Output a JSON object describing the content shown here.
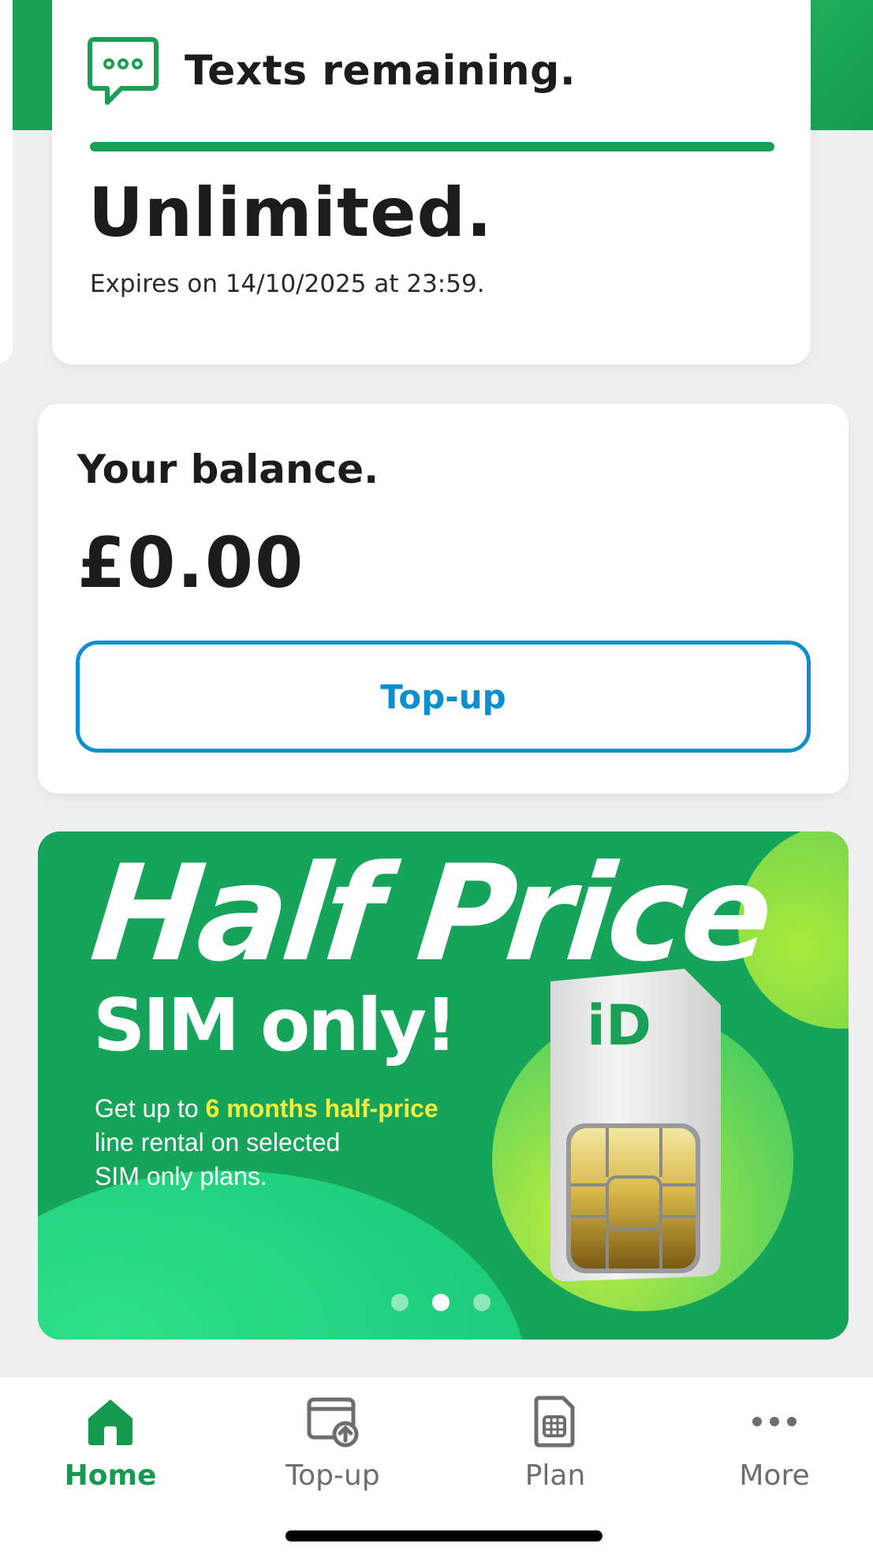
{
  "texts_card": {
    "title": "Texts remaining.",
    "value": "Unlimited.",
    "expiry": "Expires on 14/10/2025 at 23:59.",
    "remaining_fraction": 1.0,
    "icon": "sms-bubble-icon"
  },
  "balance_card": {
    "label": "Your balance.",
    "value": "£0.00",
    "topup_button": "Top-up"
  },
  "promo": {
    "headline": "Half Price",
    "subheadline": "SIM only!",
    "body_prefix": "Get up to ",
    "body_highlight": "6 months half-price",
    "body_suffix_line1": "line rental on selected",
    "body_suffix_line2": "SIM only plans.",
    "logo_text": "iD",
    "carousel": {
      "count": 3,
      "active_index": 1
    }
  },
  "tabbar": {
    "items": [
      {
        "label": "Home",
        "icon": "home-icon",
        "active": true
      },
      {
        "label": "Top-up",
        "icon": "topup-icon",
        "active": false
      },
      {
        "label": "Plan",
        "icon": "sim-plan-icon",
        "active": false
      },
      {
        "label": "More",
        "icon": "more-dots-icon",
        "active": false
      }
    ]
  },
  "colors": {
    "brand_green": "#1aa055",
    "topup_blue": "#0b8fcf",
    "highlight_yellow": "#f4ec3a"
  }
}
